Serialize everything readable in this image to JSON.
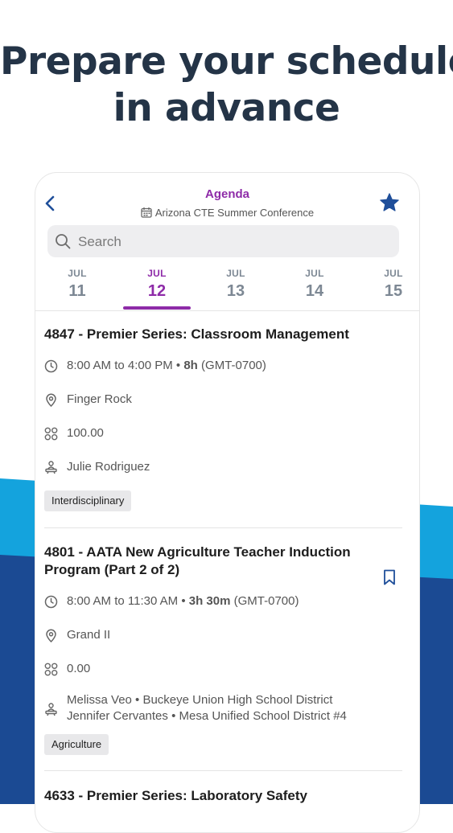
{
  "headline": {
    "line1": "Prepare your schedule",
    "line2": "in advance"
  },
  "colors": {
    "accent": "#8e2ba8",
    "brand_dark": "#1b4a93",
    "brand_light": "#14a3dd",
    "star": "#1f4f9a"
  },
  "header": {
    "title": "Agenda",
    "subtitle": "Arizona CTE Summer Conference",
    "icons": {
      "back": "chevron-left-icon",
      "favorite": "star-icon",
      "event": "calendar-icon"
    }
  },
  "search": {
    "placeholder": "Search",
    "value": ""
  },
  "dates": [
    {
      "month": "JUL",
      "day": "11",
      "active": false
    },
    {
      "month": "JUL",
      "day": "12",
      "active": true
    },
    {
      "month": "JUL",
      "day": "13",
      "active": false
    },
    {
      "month": "JUL",
      "day": "14",
      "active": false
    },
    {
      "month": "JUL",
      "day": "15",
      "active": false
    }
  ],
  "sessions": [
    {
      "title": "4847 - Premier Series: Classroom Management",
      "time": "8:00 AM to 4:00 PM",
      "duration": "8h",
      "timezone": "(GMT-0700)",
      "location": "Finger Rock",
      "credits": "100.00",
      "presenters": [
        "Julie Rodriguez"
      ],
      "tag": "Interdisciplinary"
    },
    {
      "title_line1": "4801 - AATA New Agriculture Teacher Induction",
      "title_line2": "Program (Part 2 of 2)",
      "time": "8:00 AM to 11:30 AM",
      "duration": "3h 30m",
      "timezone": "(GMT-0700)",
      "location": "Grand II",
      "credits": "0.00",
      "presenters": [
        "Melissa Veo • Buckeye Union High School District",
        "Jennifer Cervantes • Mesa Unified School District #4"
      ],
      "tag": "Agriculture"
    },
    {
      "title": "4633 - Premier Series: Laboratory Safety"
    }
  ]
}
